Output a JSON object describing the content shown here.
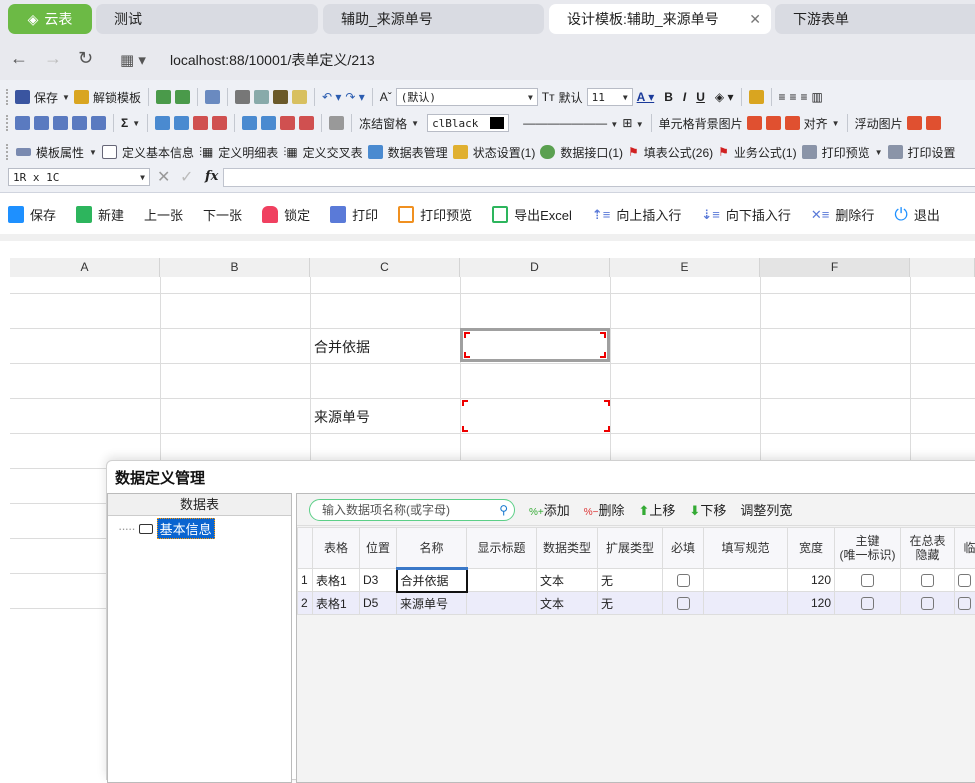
{
  "browser": {
    "brand": "云表",
    "tabs": [
      {
        "label": "测试"
      },
      {
        "label": "辅助_来源单号"
      },
      {
        "label": "设计模板:辅助_来源单号"
      },
      {
        "label": "下游表单"
      }
    ],
    "url": "localhost:88/10001/表单定义/213"
  },
  "toolbar1": {
    "save": "保存",
    "unlock": "解锁模板",
    "font": "(默认)",
    "default": "默认",
    "size": "11",
    "bold": "B",
    "italic": "I",
    "underline": "U"
  },
  "toolbar2": {
    "sigma": "Σ",
    "freeze": "冻结窗格",
    "color": "clBlack",
    "cell_bg": "单元格背景图片",
    "align": "对齐",
    "float_img": "浮动图片"
  },
  "toolbar3": {
    "items": [
      "模板属性",
      "定义基本信息",
      "定义明细表",
      "定义交叉表",
      "数据表管理",
      "状态设置(1)",
      "数据接口(1)",
      "填表公式(26)",
      "业务公式(1)",
      "打印预览",
      "打印设置"
    ]
  },
  "formula": {
    "cellref": "1R x 1C",
    "fx": "fx"
  },
  "main_toolbar": {
    "items": [
      "保存",
      "新建",
      "上一张",
      "下一张",
      "锁定",
      "打印",
      "打印预览",
      "导出Excel",
      "向上插入行",
      "向下插入行",
      "删除行",
      "退出"
    ]
  },
  "sheet": {
    "columns": [
      "A",
      "B",
      "C",
      "D",
      "E",
      "F"
    ],
    "cells": {
      "c3": "合并依据",
      "c5": "来源单号"
    }
  },
  "dialog": {
    "title": "数据定义管理",
    "left_header": "数据表",
    "tree_item": "基本信息",
    "search_placeholder": "输入数据项名称(或字母)",
    "actions": [
      "添加",
      "删除",
      "上移",
      "下移",
      "调整列宽"
    ],
    "columns": [
      "",
      "表格",
      "位置",
      "名称",
      "显示标题",
      "数据类型",
      "扩展类型",
      "必填",
      "填写规范",
      "宽度",
      "主键\n(唯一标识)",
      "在总表\n隐藏",
      "临"
    ],
    "rows": [
      [
        "1",
        "表格1",
        "D3",
        "合并依据",
        "",
        "文本",
        "无",
        "",
        "",
        "120"
      ],
      [
        "2",
        "表格1",
        "D5",
        "来源单号",
        "",
        "文本",
        "无",
        "",
        "",
        "120"
      ]
    ]
  }
}
